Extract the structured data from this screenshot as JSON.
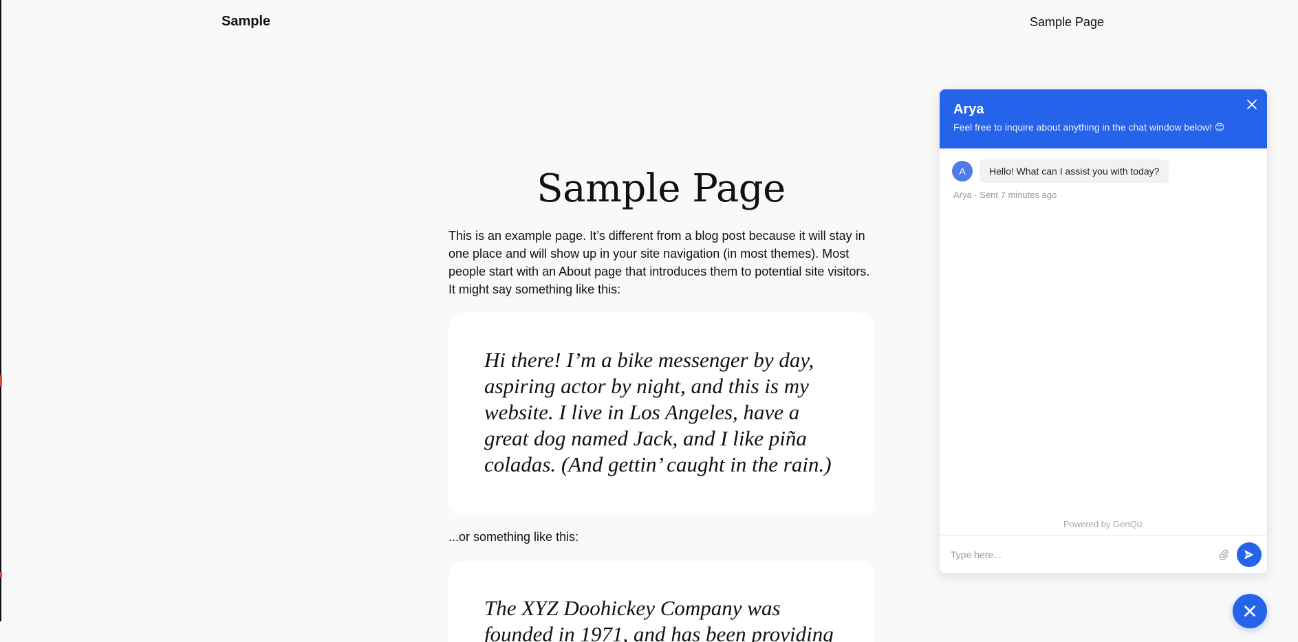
{
  "header": {
    "site_title": "Sample",
    "nav": [
      "Sample Page"
    ]
  },
  "main": {
    "heading": "Sample Page",
    "intro": "This is an example page. It’s different from a blog post because it will stay in one place and will show up in your site navigation (in most themes). Most people start with an About page that introduces them to potential site visitors. It might say something like this:",
    "quote1": "Hi there! I’m a bike messenger by day, aspiring actor by night, and this is my website. I live in Los Angeles, have a great dog named Jack, and I like piña coladas. (And gettin’ caught in the rain.)",
    "between": "...or something like this:",
    "quote2": "The XYZ Doohickey Company was founded in 1971, and has been providing"
  },
  "chat": {
    "agent_name": "Arya",
    "subtitle": "Feel free to inquire about anything in the chat window below! 😊",
    "avatar_letter": "A",
    "message": "Hello! What can I assist you with today?",
    "message_meta": "Arya · Sent 7 minutes ago",
    "powered_by": "Powered by GenQiz",
    "input_placeholder": "Type here...",
    "accent_color": "#2563eb",
    "icons": {
      "close": "close-icon",
      "attach": "paperclip-icon",
      "send": "send-icon",
      "launcher": "close-icon"
    }
  }
}
